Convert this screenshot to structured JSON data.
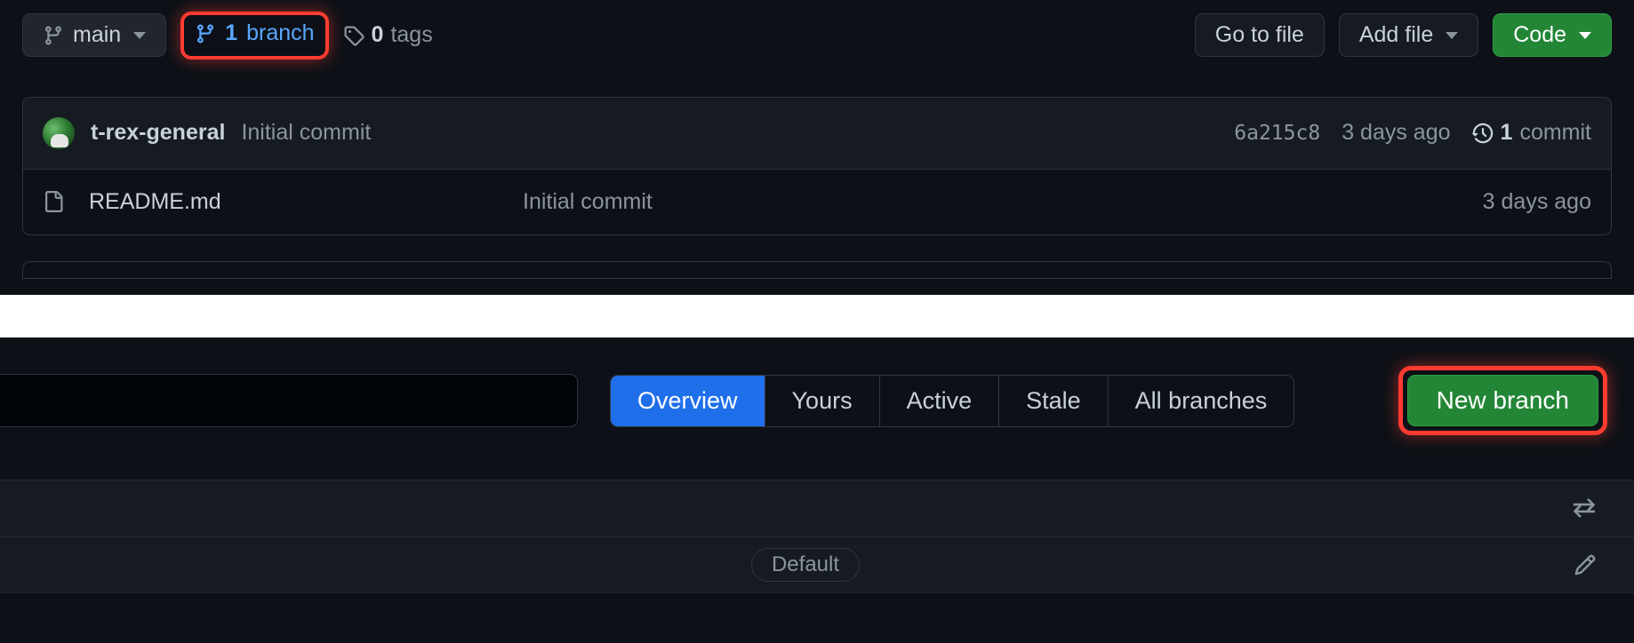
{
  "toolbar": {
    "branch_selector_label": "main",
    "branches_count": "1",
    "branches_word": "branch",
    "tags_count": "0",
    "tags_word": "tags",
    "go_to_file": "Go to file",
    "add_file": "Add file",
    "code": "Code"
  },
  "commit": {
    "author": "t-rex-general",
    "message": "Initial commit",
    "sha": "6a215c8",
    "time": "3 days ago",
    "commit_count": "1",
    "commit_word": "commit"
  },
  "files": [
    {
      "name": "README.md",
      "msg": "Initial commit",
      "time": "3 days ago"
    }
  ],
  "branches_page": {
    "tabs": [
      "Overview",
      "Yours",
      "Active",
      "Stale",
      "All branches"
    ],
    "active_tab": "Overview",
    "new_branch": "New branch",
    "default_chip": "Default"
  }
}
